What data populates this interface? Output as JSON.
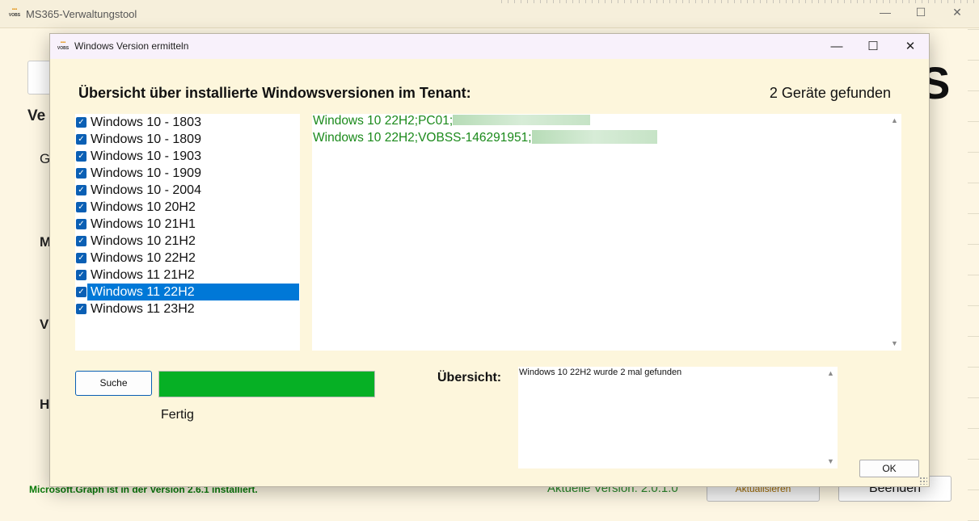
{
  "main_window": {
    "title": "MS365-Verwaltungstool",
    "logo_text": "VOBS",
    "left_letters": [
      "Ve",
      "G",
      "M",
      "V",
      "H"
    ],
    "partial_heading": "S",
    "status_text": "Microsoft.Graph ist in der Version 2.6.1 installiert.",
    "version_text": "Aktuelle Version: 2.0.1.0",
    "update_button": "Aktualisieren",
    "exit_button": "Beenden"
  },
  "dialog": {
    "title": "Windows Version ermitteln",
    "logo_text": "VOBS",
    "heading": "Übersicht über installierte Windowsversionen im Tenant:",
    "device_count": "2 Geräte gefunden",
    "versions": [
      {
        "label": "Windows 10 - 1803",
        "checked": true,
        "selected": false
      },
      {
        "label": "Windows 10 - 1809",
        "checked": true,
        "selected": false
      },
      {
        "label": "Windows 10 - 1903",
        "checked": true,
        "selected": false
      },
      {
        "label": "Windows 10 - 1909",
        "checked": true,
        "selected": false
      },
      {
        "label": "Windows 10 - 2004",
        "checked": true,
        "selected": false
      },
      {
        "label": "Windows 10 20H2",
        "checked": true,
        "selected": false
      },
      {
        "label": "Windows 10 21H1",
        "checked": true,
        "selected": false
      },
      {
        "label": "Windows 10 21H2",
        "checked": true,
        "selected": false
      },
      {
        "label": "Windows 10 22H2",
        "checked": true,
        "selected": false
      },
      {
        "label": "Windows 11 21H2",
        "checked": true,
        "selected": false
      },
      {
        "label": "Windows 11 22H2",
        "checked": true,
        "selected": true
      },
      {
        "label": "Windows 11 23H2",
        "checked": true,
        "selected": false
      }
    ],
    "results": [
      "Windows 10 22H2;PC01;",
      "Windows 10 22H2;VOBSS-146291951;"
    ],
    "search_button": "Suche",
    "progress": 1.0,
    "progress_color": "#06b025",
    "status": "Fertig",
    "summary_label": "Übersicht:",
    "summary_text": "Windows 10 22H2 wurde 2 mal gefunden",
    "ok_button": "OK",
    "accent_color": "#0078d7"
  }
}
